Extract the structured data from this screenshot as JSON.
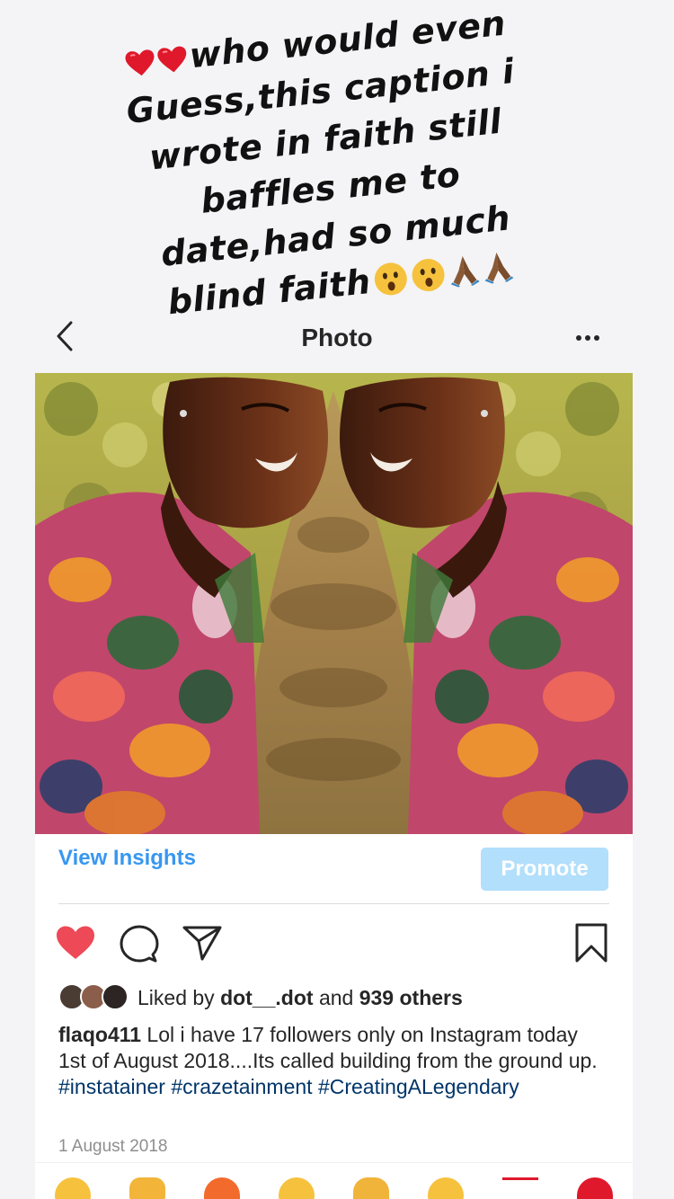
{
  "story_caption": {
    "line1": "who would even",
    "line2": "Guess,this caption i",
    "line3": "wrote in faith still",
    "line4": "baffles me to",
    "line5": "date,had so much",
    "line6": "blind faith",
    "emojis": [
      "red-heart",
      "red-heart",
      "astonished-face",
      "astonished-face",
      "folded-hands",
      "folded-hands"
    ]
  },
  "header": {
    "title": "Photo",
    "back_icon": "chevron-left-icon",
    "more_icon": "more-dots-icon"
  },
  "post": {
    "insights_label": "View Insights",
    "promote_label": "Promote",
    "liked_by_prefix": "Liked by ",
    "liked_by_user": "dot__.dot",
    "liked_by_and": " and ",
    "liked_by_others": "939 others",
    "username": "flaqo411",
    "caption_text": " Lol i have 17 followers only on Instagram today 1st of August 2018....Its called building from the ground up. ",
    "hashtags": [
      "#instatainer",
      "#crazetainment",
      "#CreatingALegendary"
    ],
    "date": "1 August 2018",
    "liked": true
  },
  "colors": {
    "accent": "#3897f0",
    "promote_bg": "#b2dffc",
    "heart": "#ed4956",
    "hashtag": "#003569"
  }
}
